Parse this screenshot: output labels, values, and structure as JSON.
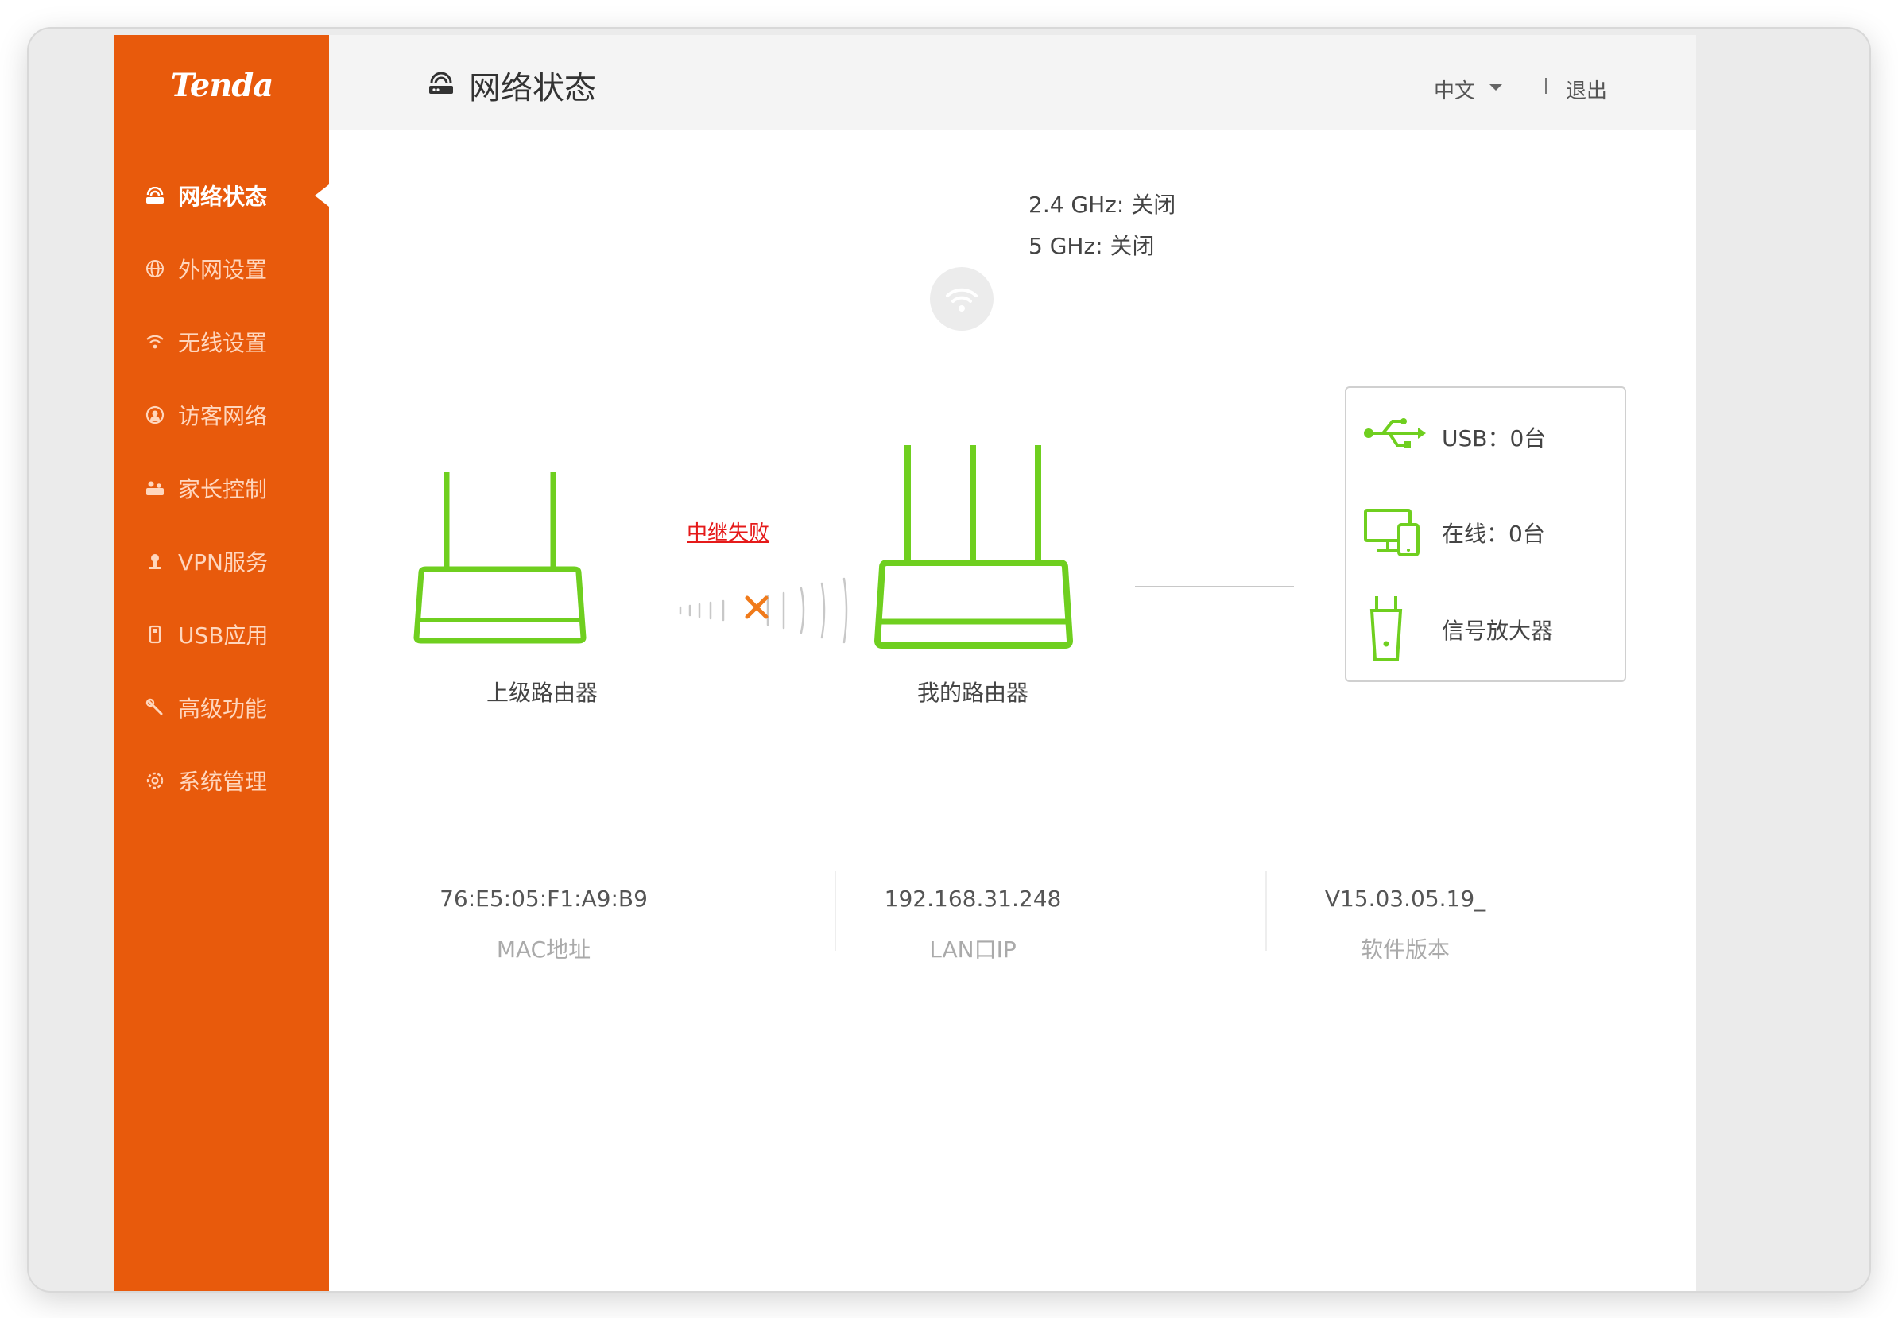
{
  "brand": {
    "logo_text": "Tenda",
    "accent_color": "#e85a0c",
    "ok_color": "#6fcf1f"
  },
  "sidebar": {
    "items": [
      {
        "label": "网络状态",
        "icon": "router-icon",
        "active": true
      },
      {
        "label": "外网设置",
        "icon": "globe-icon",
        "active": false
      },
      {
        "label": "无线设置",
        "icon": "wifi-icon",
        "active": false
      },
      {
        "label": "访客网络",
        "icon": "guest-icon",
        "active": false
      },
      {
        "label": "家长控制",
        "icon": "parental-icon",
        "active": false
      },
      {
        "label": "VPN服务",
        "icon": "vpn-icon",
        "active": false
      },
      {
        "label": "USB应用",
        "icon": "usb-icon",
        "active": false
      },
      {
        "label": "高级功能",
        "icon": "wrench-icon",
        "active": false
      },
      {
        "label": "系统管理",
        "icon": "settings-icon",
        "active": false
      }
    ]
  },
  "header": {
    "title": "网络状态",
    "language": "中文",
    "logout": "退出"
  },
  "wireless": {
    "band_24": "2.4 GHz: 关闭",
    "band_5": "5 GHz: 关闭"
  },
  "topology": {
    "upstream_label": "上级路由器",
    "my_router_label": "我的路由器",
    "relay_status": "中继失败"
  },
  "devices": {
    "usb": "USB：0台",
    "online": "在线：0台",
    "extender": "信号放大器"
  },
  "stats": [
    {
      "value": "76:E5:05:F1:A9:B9",
      "label": "MAC地址"
    },
    {
      "value": "192.168.31.248",
      "label": "LAN口IP"
    },
    {
      "value": "V15.03.05.19_",
      "label": "软件版本"
    }
  ]
}
